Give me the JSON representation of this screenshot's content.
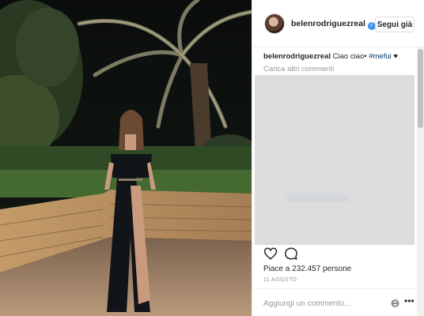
{
  "post": {
    "username": "belenrodriguezreal",
    "verified_mark": "✓",
    "follow_label": "Segui già",
    "caption_user": "belenrodriguezreal",
    "caption_text": "Ciao ciao•",
    "caption_hashtag": "#mefui",
    "caption_heart": "♥",
    "load_more": "Carica altri commenti",
    "likes_text": "Piace a 232.457 persone",
    "date": "11 AGOSTO",
    "comment_placeholder": "Aggiungi un commento...",
    "more_label": "•••"
  },
  "icons": {
    "like": "heart-outline-icon",
    "comment": "speech-bubble-icon",
    "emoji": "emoji-updown-icon",
    "more": "more-options-icon",
    "verified": "verified-badge-icon"
  },
  "colors": {
    "verified": "#3897f0",
    "hashtag": "#003569",
    "muted": "#999999",
    "text": "#262626"
  }
}
